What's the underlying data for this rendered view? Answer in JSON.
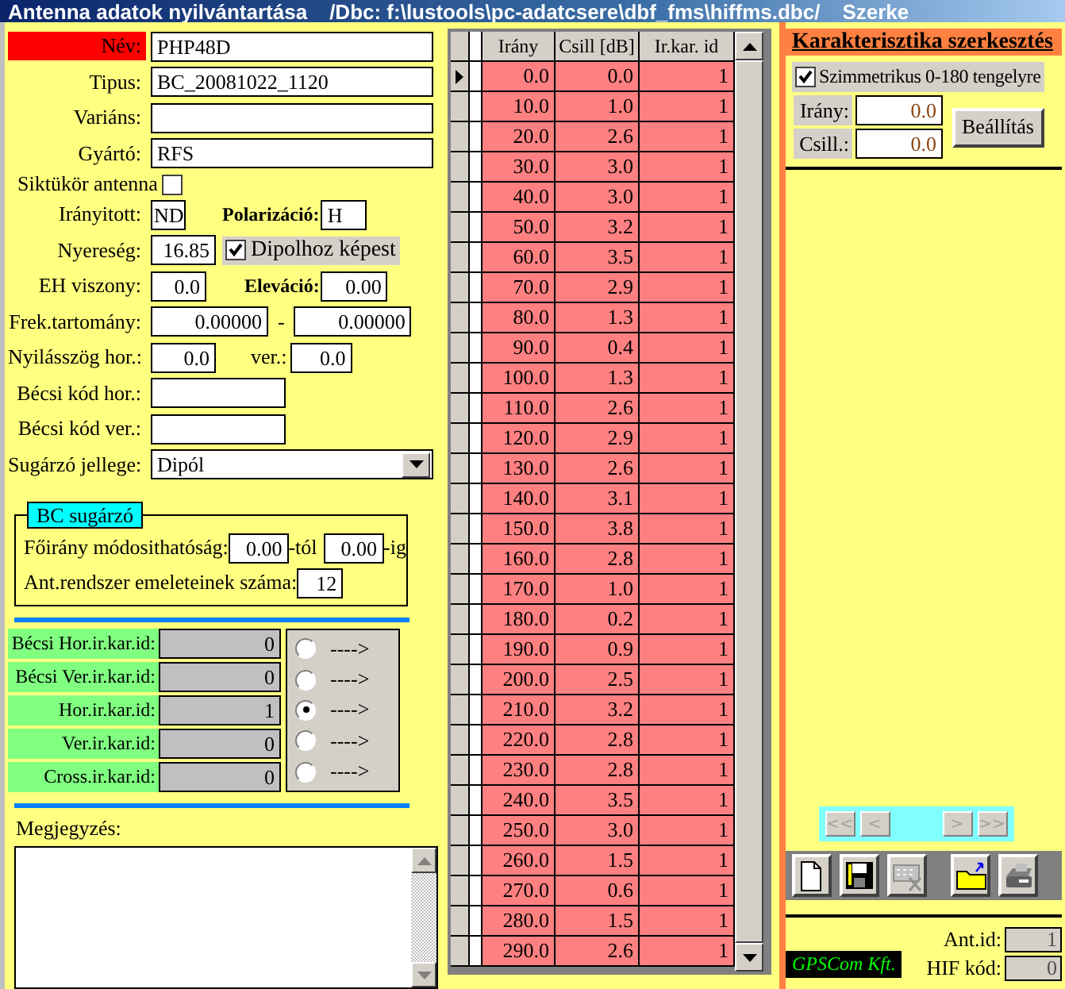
{
  "window": {
    "title": "Antenna adatok nyilvántartása",
    "path": "/Dbc: f:\\lustools\\pc-adatcsere\\dbf_fms\\hiffms.dbc/",
    "mode": "Szerke"
  },
  "main_fields": [
    {
      "label": "Név:",
      "value": "PHP48D",
      "highlight": true
    },
    {
      "label": "Tipus:",
      "value": "BC_20081022_1120",
      "highlight": false
    },
    {
      "label": "Variáns:",
      "highlight": false
    },
    {
      "label": "Gyártó:",
      "value": "RFS",
      "highlight": false
    }
  ],
  "mirror_antenna": {
    "label": "Siktükör antenna",
    "checked": false
  },
  "directed": {
    "label": "Irányitott:",
    "value": "ND"
  },
  "polarization": {
    "label": "Polarizáció:",
    "value": "H"
  },
  "gain": {
    "label": "Nyereség:",
    "value": "16.85"
  },
  "dipole_ref": {
    "label": "Dipolhoz képest",
    "checked": true
  },
  "eh_ratio": {
    "label": "EH viszony:",
    "value": "0.0"
  },
  "elevation": {
    "label": "Eleváció:",
    "value": "0.00"
  },
  "freq_range": {
    "label": "Frek.tartomány:",
    "from": "0.00000",
    "separator": "-",
    "to": "0.00000"
  },
  "beamwidth": {
    "label": "Nyilásszög hor.:",
    "hor": "0.0",
    "ver_label": "ver.:",
    "ver": "0.0"
  },
  "vienna_codes": [
    {
      "label": "Bécsi kód hor.:"
    },
    {
      "label": "Bécsi kód ver.:"
    }
  ],
  "radiator_type": {
    "label": "Sugárzó jellege:",
    "value": "Dipól"
  },
  "bc_radiator": {
    "title": "BC sugárzó",
    "adjust_label": "Főirány módosithatóság:",
    "from": "0.00",
    "from_suffix": "-tól",
    "to": "0.00",
    "to_suffix": "-ig",
    "floors_label": "Ant.rendszer emeleteinek száma:",
    "floors": "12"
  },
  "pattern_ids": [
    {
      "label": "Bécsi Hor.ir.kar.id:",
      "value": "0",
      "selected": false,
      "arrow": "---->"
    },
    {
      "label": "Bécsi Ver.ir.kar.id:",
      "value": "0",
      "selected": false,
      "arrow": "---->"
    },
    {
      "label": "Hor.ir.kar.id:",
      "value": "1",
      "selected": true,
      "arrow": "---->"
    },
    {
      "label": "Ver.ir.kar.id:",
      "value": "0",
      "selected": false,
      "arrow": "---->"
    },
    {
      "label": "Cross.ir.kar.id:",
      "value": "0",
      "selected": false,
      "arrow": "---->"
    }
  ],
  "notes": {
    "label": "Megjegyzés:"
  },
  "table": {
    "columns": [
      "Irány",
      "Csill [dB]",
      "Ir.kar. id"
    ],
    "rows": [
      {
        "cells": [
          "0.0",
          "0.0",
          "1"
        ],
        "current": true
      },
      {
        "cells": [
          "10.0",
          "1.0",
          "1"
        ],
        "current": false
      },
      {
        "cells": [
          "20.0",
          "2.6",
          "1"
        ],
        "current": false
      },
      {
        "cells": [
          "30.0",
          "3.0",
          "1"
        ],
        "current": false
      },
      {
        "cells": [
          "40.0",
          "3.0",
          "1"
        ],
        "current": false
      },
      {
        "cells": [
          "50.0",
          "3.2",
          "1"
        ],
        "current": false
      },
      {
        "cells": [
          "60.0",
          "3.5",
          "1"
        ],
        "current": false
      },
      {
        "cells": [
          "70.0",
          "2.9",
          "1"
        ],
        "current": false
      },
      {
        "cells": [
          "80.0",
          "1.3",
          "1"
        ],
        "current": false
      },
      {
        "cells": [
          "90.0",
          "0.4",
          "1"
        ],
        "current": false
      },
      {
        "cells": [
          "100.0",
          "1.3",
          "1"
        ],
        "current": false
      },
      {
        "cells": [
          "110.0",
          "2.6",
          "1"
        ],
        "current": false
      },
      {
        "cells": [
          "120.0",
          "2.9",
          "1"
        ],
        "current": false
      },
      {
        "cells": [
          "130.0",
          "2.6",
          "1"
        ],
        "current": false
      },
      {
        "cells": [
          "140.0",
          "3.1",
          "1"
        ],
        "current": false
      },
      {
        "cells": [
          "150.0",
          "3.8",
          "1"
        ],
        "current": false
      },
      {
        "cells": [
          "160.0",
          "2.8",
          "1"
        ],
        "current": false
      },
      {
        "cells": [
          "170.0",
          "1.0",
          "1"
        ],
        "current": false
      },
      {
        "cells": [
          "180.0",
          "0.2",
          "1"
        ],
        "current": false
      },
      {
        "cells": [
          "190.0",
          "0.9",
          "1"
        ],
        "current": false
      },
      {
        "cells": [
          "200.0",
          "2.5",
          "1"
        ],
        "current": false
      },
      {
        "cells": [
          "210.0",
          "3.2",
          "1"
        ],
        "current": false
      },
      {
        "cells": [
          "220.0",
          "2.8",
          "1"
        ],
        "current": false
      },
      {
        "cells": [
          "230.0",
          "2.8",
          "1"
        ],
        "current": false
      },
      {
        "cells": [
          "240.0",
          "3.5",
          "1"
        ],
        "current": false
      },
      {
        "cells": [
          "250.0",
          "3.0",
          "1"
        ],
        "current": false
      },
      {
        "cells": [
          "260.0",
          "1.5",
          "1"
        ],
        "current": false
      },
      {
        "cells": [
          "270.0",
          "0.6",
          "1"
        ],
        "current": false
      },
      {
        "cells": [
          "280.0",
          "1.5",
          "1"
        ],
        "current": false
      },
      {
        "cells": [
          "290.0",
          "2.6",
          "1"
        ],
        "current": false
      }
    ]
  },
  "editor": {
    "title": "Karakterisztika szerkesztés",
    "symmetric": {
      "label": "Szimmetrikus 0-180 tengelyre",
      "checked": true
    },
    "direction": {
      "label": "Irány:",
      "value": "0.0"
    },
    "gain": {
      "label": "Csill.:",
      "value": "0.0"
    },
    "apply_button": "Beállítás"
  },
  "navigation": [
    {
      "label": "<<",
      "disabled": true
    },
    {
      "label": "<",
      "disabled": true
    },
    {
      "label": ">",
      "disabled": true
    },
    {
      "label": ">>",
      "disabled": true
    }
  ],
  "toolbar": [
    {
      "kind": "new",
      "disabled": false
    },
    {
      "kind": "save",
      "disabled": false
    },
    {
      "kind": "cancel",
      "disabled": true
    },
    {
      "kind": "open",
      "disabled": false
    },
    {
      "kind": "print",
      "disabled": false
    }
  ],
  "company": "GPSCom Kft.",
  "ant_id": {
    "label": "Ant.id:",
    "value": "1"
  },
  "hif_code": {
    "label": "HIF kód:",
    "value": "0"
  }
}
